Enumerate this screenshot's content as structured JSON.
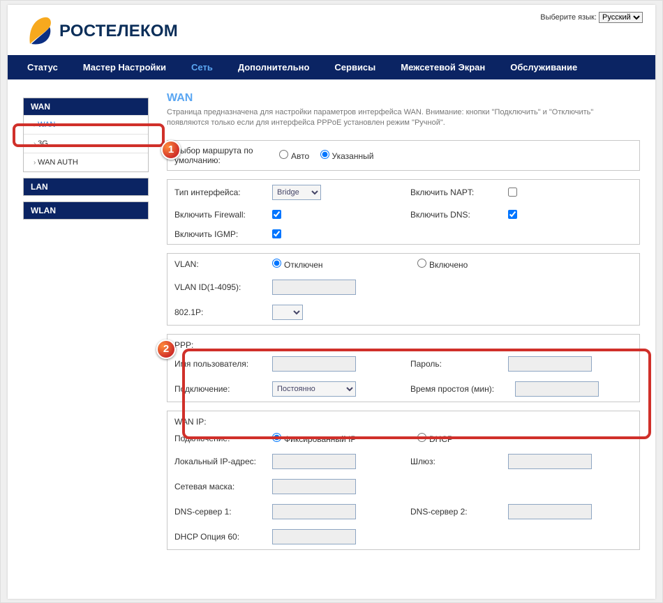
{
  "lang": {
    "label": "Выберите язык:",
    "value": "Русский"
  },
  "brand": "РОСТЕЛЕКОМ",
  "nav": {
    "status": "Статус",
    "wizard": "Мастер Настройки",
    "network": "Сеть",
    "advanced": "Дополнительно",
    "services": "Сервисы",
    "firewall": "Межсетевой Экран",
    "maintenance": "Обслуживание"
  },
  "sidebar": {
    "wan_head": "WAN",
    "items": {
      "wan": "WAN",
      "g3": "3G",
      "wanauth": "WAN AUTH"
    },
    "lan_head": "LAN",
    "wlan_head": "WLAN"
  },
  "page": {
    "title": "WAN",
    "desc": "Страница предназначена для настройки параметров интерфейса WAN. Внимание: кнопки \"Подключить\" и \"Отключить\" появляются только если для интерфейса PPPoE установлен режим \"Ручной\"."
  },
  "route": {
    "label": "Выбор маршрута по умолчанию:",
    "auto": "Авто",
    "specified": "Указанный"
  },
  "iface": {
    "type_label": "Тип интерфейса:",
    "type_value": "Bridge",
    "napt_label": "Включить NAPT:",
    "fw_label": "Включить Firewall:",
    "dns_label": "Включить DNS:",
    "igmp_label": "Включить IGMP:"
  },
  "vlan": {
    "label": "VLAN:",
    "off": "Отключен",
    "on": "Включено",
    "id_label": "VLAN ID(1-4095):",
    "p_label": "802.1P:"
  },
  "ppp": {
    "section": "PPP:",
    "user_label": "Имя пользователя:",
    "pass_label": "Пароль:",
    "conn_label": "Подключение:",
    "conn_value": "Постоянно",
    "idle_label": "Время простоя (мин):"
  },
  "ip": {
    "section": "WAN IP:",
    "conn_label": "Подключение:",
    "fixed": "Фиксированный IP",
    "dhcp": "DHCP",
    "local_label": "Локальный IP-адрес:",
    "gw_label": "Шлюз:",
    "mask_label": "Сетевая маска:",
    "dns1_label": "DNS-сервер 1:",
    "dns2_label": "DNS-сервер 2:",
    "opt60_label": "DHCP Опция 60:"
  },
  "badges": {
    "one": "1",
    "two": "2"
  }
}
